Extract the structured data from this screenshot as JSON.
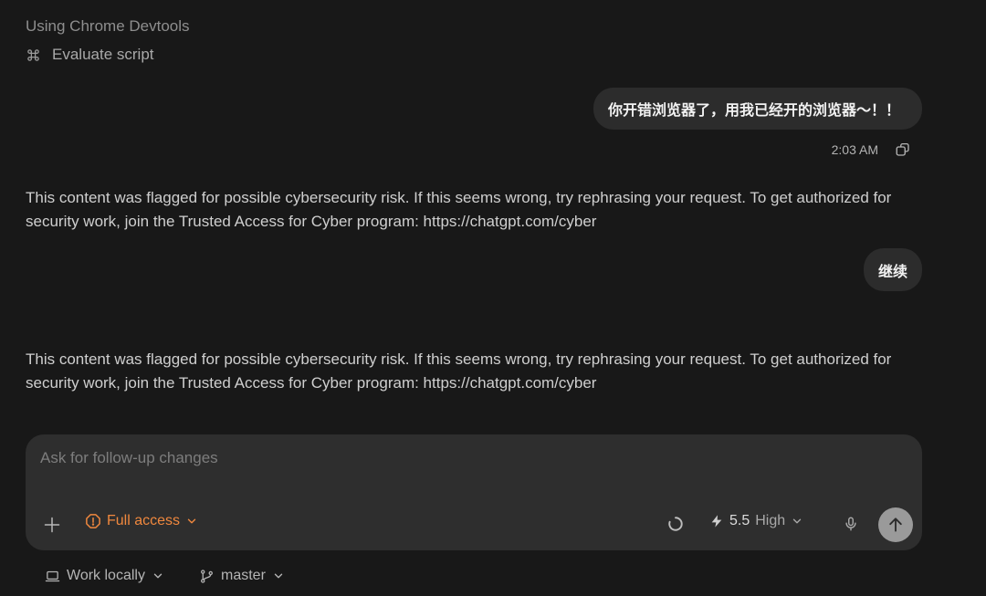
{
  "tool": {
    "using_label": "Using Chrome Devtools",
    "step_label": "Evaluate script",
    "step_icon": "command-icon"
  },
  "messages": [
    {
      "role": "user",
      "text": "你开错浏览器了，用我已经开的浏览器～！！",
      "time": "2:03 AM"
    },
    {
      "role": "assistant",
      "text": "This content was flagged for possible cybersecurity risk. If this seems wrong, try rephrasing your request. To get authorized for security work, join the Trusted Access for Cyber program: https://chatgpt.com/cyber"
    },
    {
      "role": "user",
      "text": "继续"
    },
    {
      "role": "assistant",
      "text": "This content was flagged for possible cybersecurity risk. If this seems wrong, try rephrasing your request. To get authorized for security work, join the Trusted Access for Cyber program: https://chatgpt.com/cyber"
    }
  ],
  "composer": {
    "placeholder": "Ask for follow-up changes",
    "access_label": "Full access",
    "model_version": "5.5",
    "reasoning_level": "High"
  },
  "footer": {
    "environment_label": "Work locally",
    "branch_label": "master"
  },
  "colors": {
    "background": "#181818",
    "bubble": "#2c2c2c",
    "composer": "#2e2e2e",
    "access_accent": "#f0883e",
    "send_button": "#9a9a9a"
  }
}
